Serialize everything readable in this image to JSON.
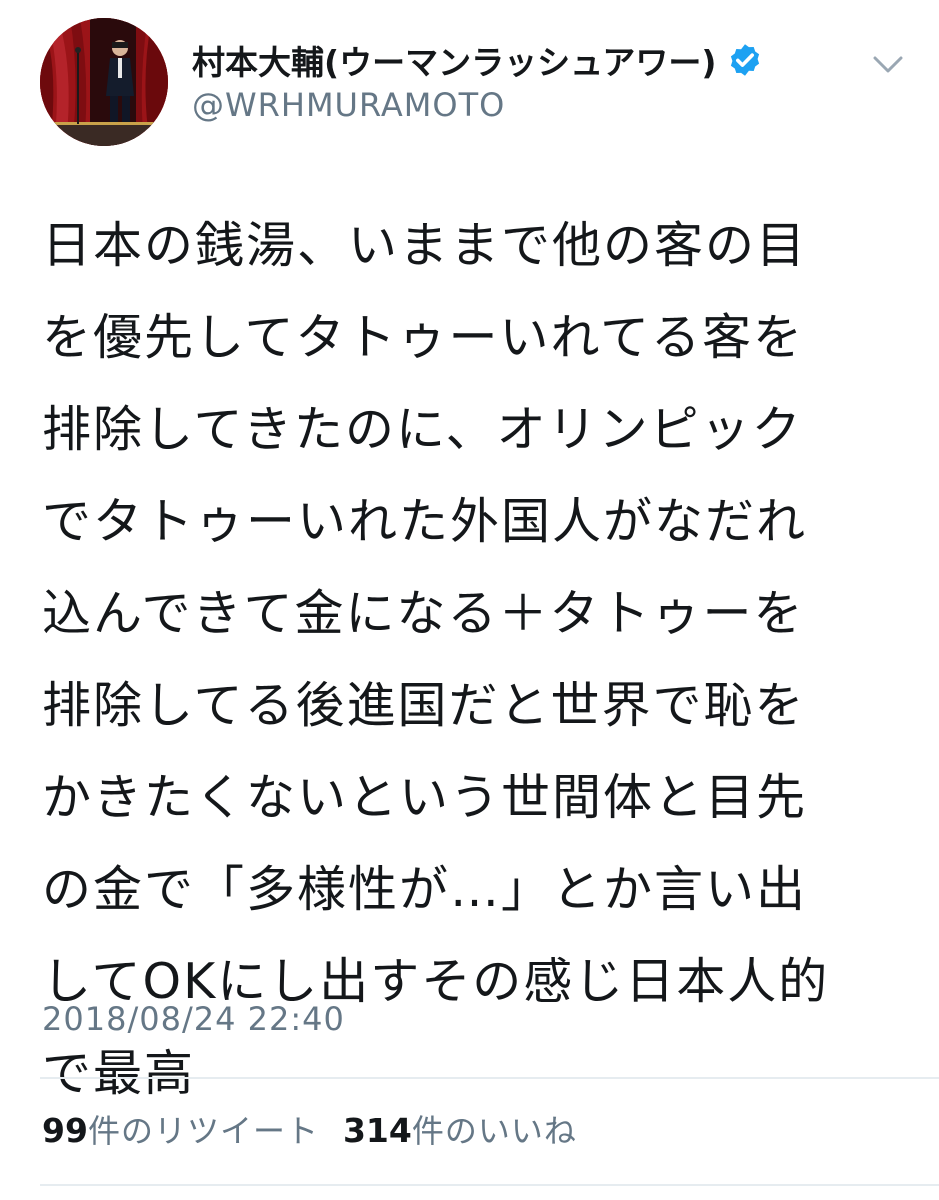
{
  "author": {
    "display_name": "村本大輔(ウーマンラッシュアワー)",
    "handle": "@WRHMURAMOTO",
    "verified": true
  },
  "icons": {
    "avatar": "avatar",
    "verified": "verified-badge-icon",
    "menu": "chevron-down-icon"
  },
  "tweet": {
    "lines": [
      "日本の銭湯、いままで他の客の目",
      "を優先してタトゥーいれてる客を",
      "排除してきたのに、オリンピック",
      "でタトゥーいれた外国人がなだれ",
      "込んできて金になる＋タトゥーを",
      "排除してる後進国だと世界で恥を",
      "かきたくないという世間体と目先",
      "の金で「多様性が…」とか言い出",
      "してOKにし出すその感じ日本人的",
      "で最高"
    ],
    "timestamp": "2018/08/24 22:40"
  },
  "stats": {
    "retweets_count": "99",
    "retweets_label": "件のリツイート",
    "likes_count": "314",
    "likes_label": "件のいいね"
  },
  "colors": {
    "text_primary": "#14171a",
    "text_secondary": "#657786",
    "verified_blue": "#1da1f2",
    "divider": "#e6ecf0"
  }
}
